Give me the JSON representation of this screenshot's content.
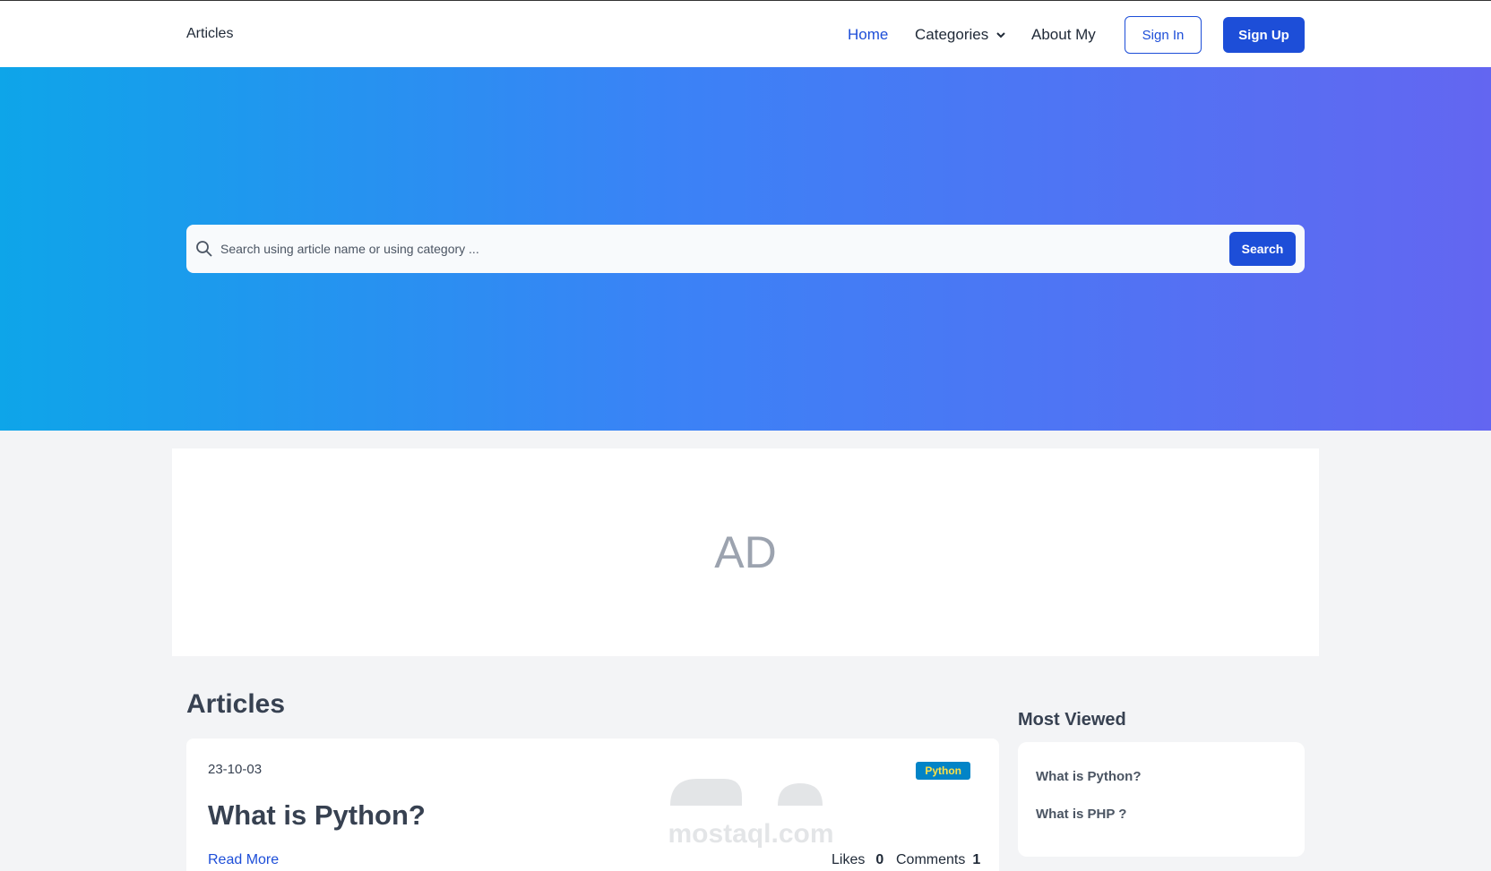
{
  "header": {
    "brand": "Articles",
    "nav": {
      "home": "Home",
      "categories": "Categories",
      "about": "About My"
    },
    "sign_in": "Sign In",
    "sign_up": "Sign Up"
  },
  "hero": {
    "search": {
      "placeholder": "Search using article name or using category ...",
      "value": "",
      "button": "Search"
    }
  },
  "ad": {
    "text": "AD"
  },
  "articles": {
    "title": "Articles",
    "items": [
      {
        "date": "23-10-03",
        "tag": "Python",
        "title": "What is Python?",
        "read_more": "Read More",
        "likes_label": "Likes",
        "likes": "0",
        "comments_label": "Comments",
        "comments": "1"
      }
    ]
  },
  "most_viewed": {
    "title": "Most Viewed",
    "items": [
      "What is Python?",
      "What is PHP ?"
    ]
  },
  "watermark": {
    "text": "mostaql.com"
  },
  "colors": {
    "primary": "#1d4ed8",
    "gradient_start": "#0ea5e9",
    "gradient_end": "#6366f1",
    "tag_bg": "#0284c7",
    "tag_fg": "#fde047"
  }
}
